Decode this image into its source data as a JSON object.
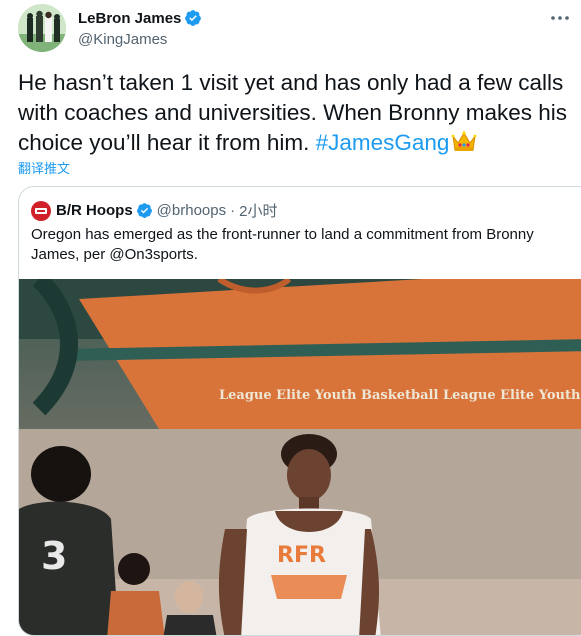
{
  "tweet": {
    "author_name": "LeBron James",
    "handle": "@KingJames",
    "text": "He hasn’t taken 1 visit yet and has only had a few calls with coaches and universities. When Bronny makes his choice you’ll hear it from him.",
    "hashtag": "#JamesGang",
    "translate_label": "翻译推文"
  },
  "quoted": {
    "author_name": "B/R Hoops",
    "handle": "@brhoops",
    "separator": "·",
    "time": "2小时",
    "text": "Oregon has emerged as the front-runner to land a commitment from Bronny James, per @On3sports.",
    "image_banner_text": "League Elite Youth Basketball League Elite Youth Basketba",
    "jersey_number": "3"
  },
  "icons": {
    "verified": "verified-badge-icon",
    "more": "more-options-icon",
    "emoji": "crown-emoji"
  },
  "colors": {
    "link": "#1d9bf0",
    "secondary_text": "#536471",
    "border": "#cfd9de"
  }
}
